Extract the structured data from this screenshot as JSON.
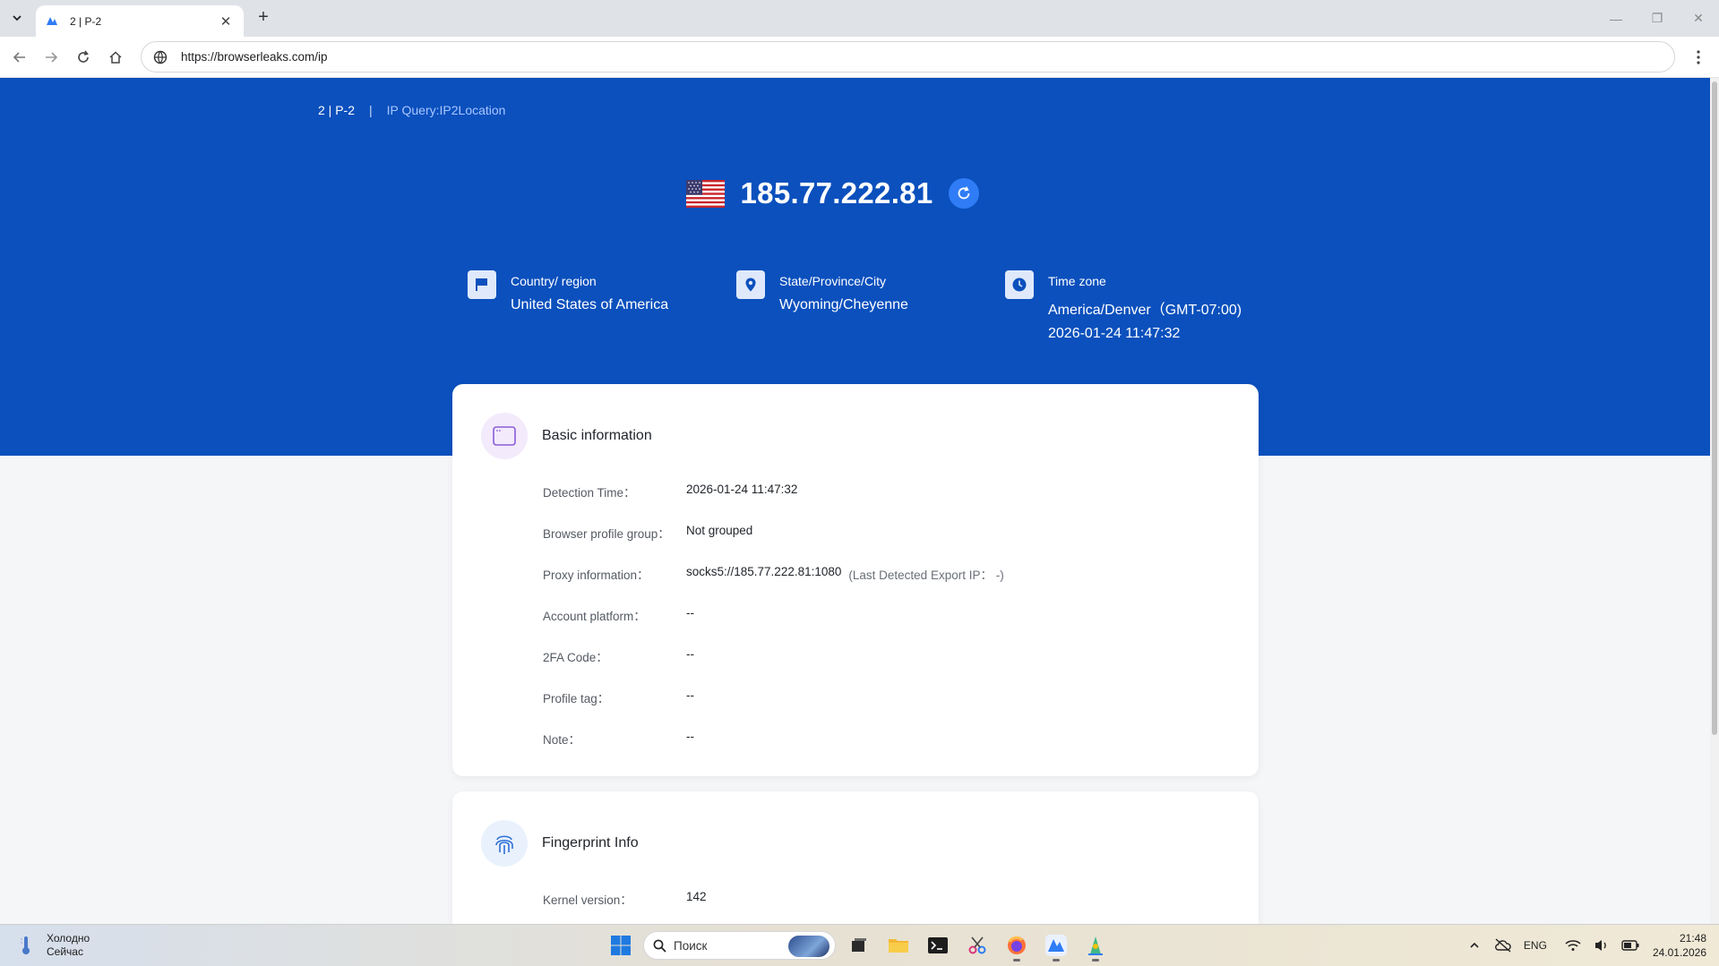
{
  "browser": {
    "tab_title": "2 | P-2",
    "tab_close": "✕",
    "new_tab": "+",
    "url": "https://browserleaks.com/ip",
    "win_minimize": "—",
    "win_restore": "❐",
    "win_close": "✕"
  },
  "header": {
    "breadcrumb_profile": "2 | P-2",
    "breadcrumb_separator": "|",
    "breadcrumb_query": "IP Query:IP2Location",
    "ip_address": "185.77.222.81",
    "flag_icon": "us-flag-icon"
  },
  "geo": {
    "country_label": "Country/ region",
    "country_value": "United States of America",
    "state_label": "State/Province/City",
    "state_value": "Wyoming/Cheyenne",
    "timezone_label": "Time zone",
    "timezone_value": "America/Denver（GMT-07:00)",
    "timezone_datetime": "2026-01-24 11:47:32"
  },
  "basic_info": {
    "title": "Basic information",
    "rows": [
      {
        "label": "Detection Time：",
        "value": "2026-01-24 11:47:32"
      },
      {
        "label": "Browser profile group：",
        "value": "Not grouped"
      },
      {
        "label": "Proxy information：",
        "value": "socks5://185.77.222.81:1080",
        "extra": "(Last Detected Export IP： -)"
      },
      {
        "label": "Account platform：",
        "value": "--"
      },
      {
        "label": "2FA Code：",
        "value": "--"
      },
      {
        "label": "Profile tag：",
        "value": "--"
      },
      {
        "label": "Note：",
        "value": "--"
      }
    ]
  },
  "fingerprint_info": {
    "title": "Fingerprint Info",
    "rows": [
      {
        "label": "Kernel version：",
        "value": "142"
      }
    ]
  },
  "taskbar": {
    "weather_title": "Холодно",
    "weather_sub": "Сейчас",
    "search_placeholder": "Поиск",
    "language": "ENG",
    "time": "21:48",
    "date": "24.01.2026"
  },
  "colors": {
    "hero_bg": "#0b50bd",
    "accent": "#2f7cf6",
    "card_bg": "#ffffff",
    "page_bg": "#f5f6f8"
  }
}
